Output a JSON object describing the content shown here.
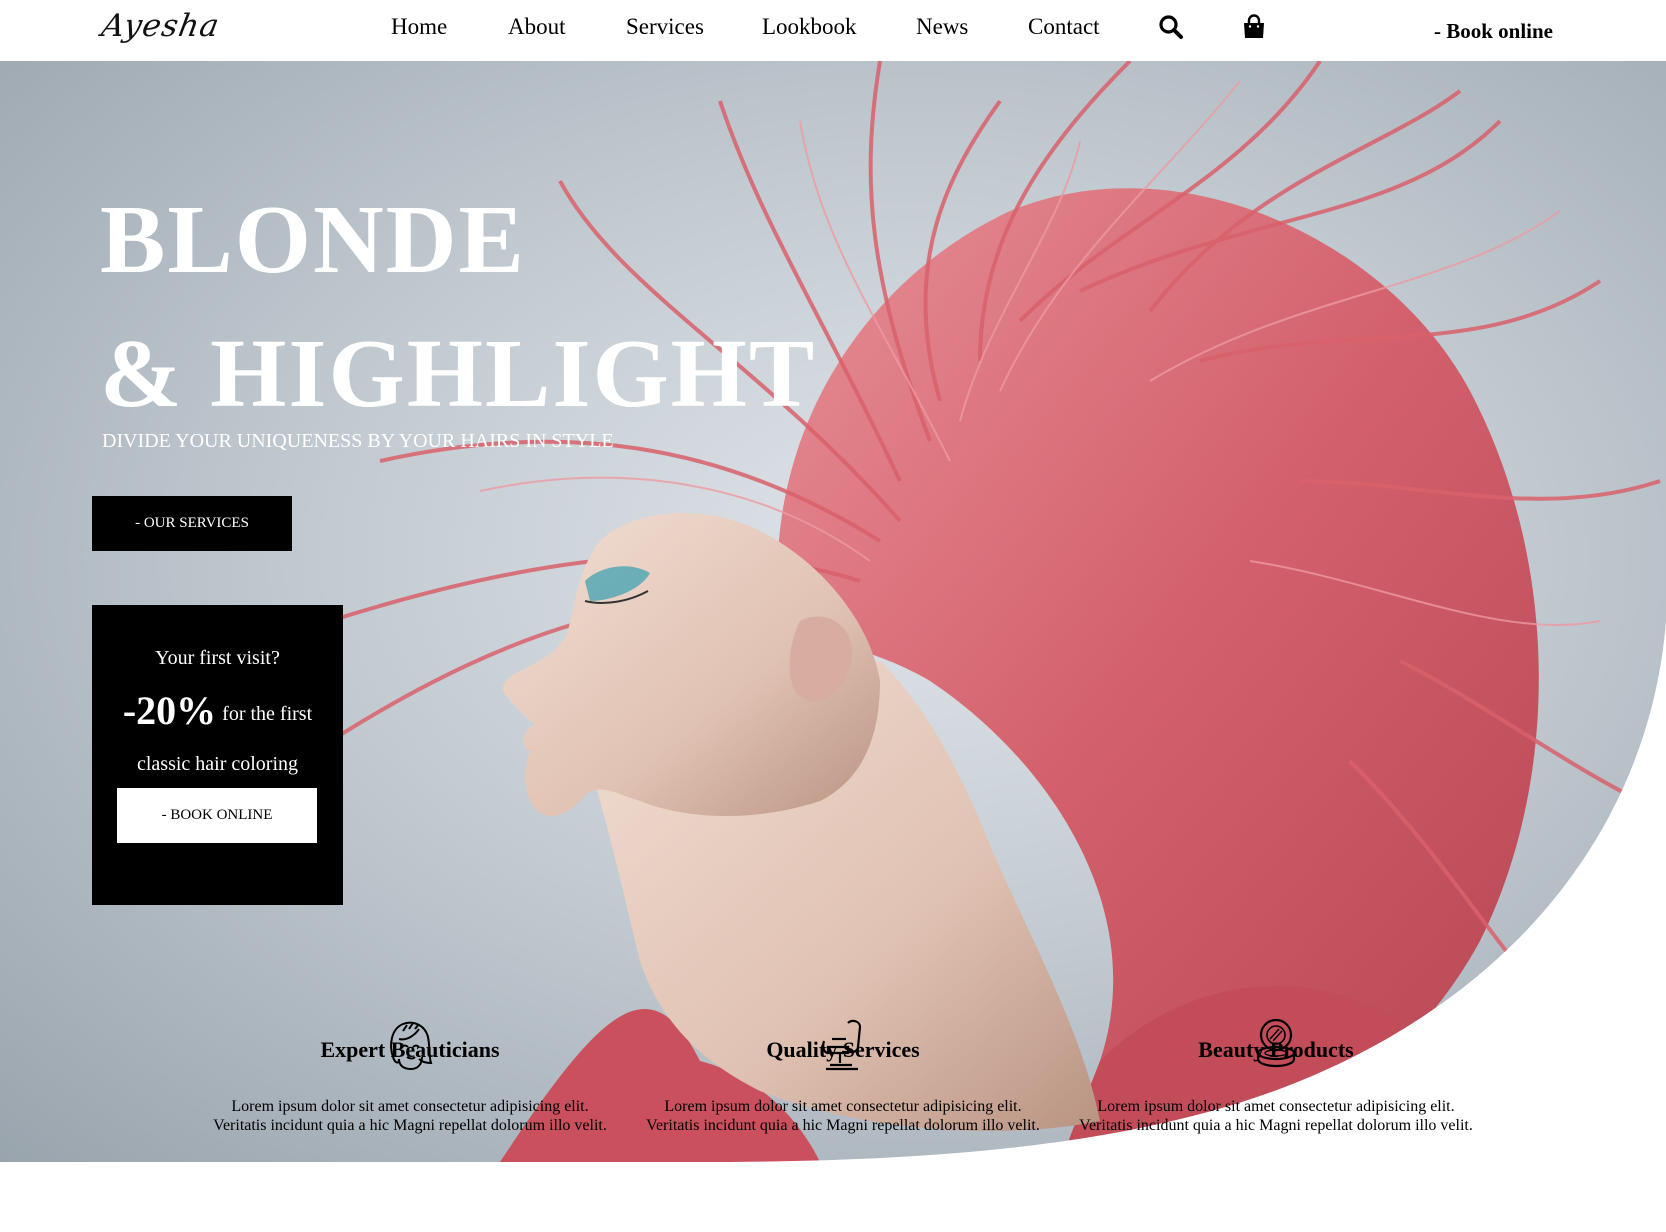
{
  "header": {
    "logo": "Ayesha",
    "nav": [
      "Home",
      "About",
      "Services",
      "Lookbook",
      "News",
      "Contact"
    ],
    "icons": [
      "search-icon",
      "shopping-bag-icon"
    ],
    "book_online": "- Book online"
  },
  "hero": {
    "title_line1": "BLONDE",
    "title_line2": "& HIGHLIGHT",
    "subtitle": "DIVIDE YOUR UNIQUENESS BY YOUR HAIRS IN STYLE",
    "services_button": "- OUR SERVICES",
    "hair_color": "#d9616b"
  },
  "promo": {
    "question": "Your first visit?",
    "discount": "-20%",
    "offer_text": "for the first",
    "offer_line2": "classic hair coloring",
    "button": "- BOOK ONLINE"
  },
  "features": [
    {
      "icon": "woman-face-icon",
      "title": "Expert Beauticians",
      "line1": "Lorem ipsum dolor sit amet consectetur adipisicing elit.",
      "line2": "Veritatis incidunt quia a hic Magni repellat dolorum illo velit."
    },
    {
      "icon": "barber-chair-icon",
      "title": "Quality Services",
      "line1": "Lorem ipsum dolor sit amet consectetur adipisicing elit.",
      "line2": "Veritatis incidunt quia a hic Magni repellat dolorum illo velit."
    },
    {
      "icon": "compact-powder-icon",
      "title": "Beauty Products",
      "line1": "Lorem ipsum dolor sit amet consectetur adipisicing elit.",
      "line2": "Veritatis incidunt quia a hic Magni repellat dolorum illo velit."
    }
  ]
}
